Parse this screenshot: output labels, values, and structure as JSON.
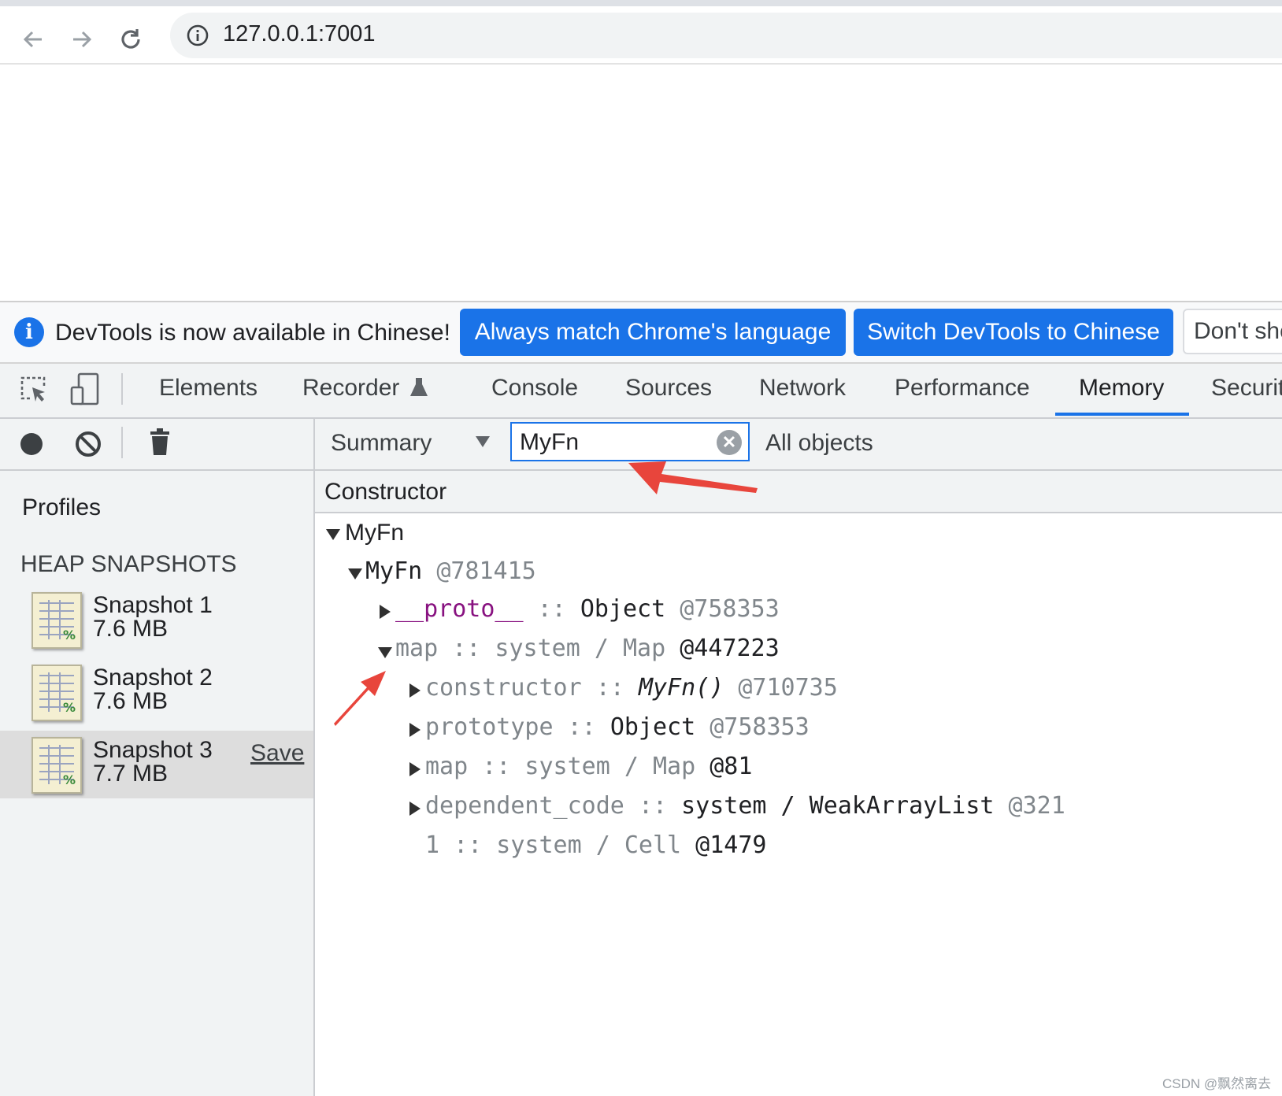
{
  "browser": {
    "url": "127.0.0.1:7001",
    "icons": [
      "back-arrow-icon",
      "forward-arrow-icon",
      "reload-icon",
      "site-info-icon"
    ]
  },
  "infobar": {
    "message": "DevTools is now available in Chinese!",
    "button_match": "Always match Chrome's language",
    "button_switch": "Switch DevTools to Chinese",
    "button_dont": "Don't show again",
    "accent": "#1a73e8"
  },
  "devtools": {
    "tabs": [
      "Elements",
      "Recorder",
      "Console",
      "Sources",
      "Network",
      "Performance",
      "Memory",
      "Security"
    ],
    "active_tab": "Memory"
  },
  "sidebar": {
    "profiles_label": "Profiles",
    "heap_label": "HEAP SNAPSHOTS",
    "snapshots": [
      {
        "name": "Snapshot 1",
        "size": "7.6 MB"
      },
      {
        "name": "Snapshot 2",
        "size": "7.6 MB"
      },
      {
        "name": "Snapshot 3",
        "size": "7.7 MB"
      }
    ],
    "save_label": "Save"
  },
  "main": {
    "view_select": "Summary",
    "filter_value": "MyFn",
    "scope_select": "All objects",
    "column_header": "Constructor",
    "tree": {
      "root": "MyFn",
      "instance_name": "MyFn",
      "instance_id": "@781415",
      "proto_key": "__proto__",
      "proto_sep": "::",
      "proto_type": "Object",
      "proto_id": "@758353",
      "map_key": "map",
      "map_sep": ":: system / Map",
      "map_id": "@447223",
      "children": {
        "constructor_key": "constructor",
        "constructor_sep": "::",
        "constructor_type": "MyFn()",
        "constructor_id": "@710735",
        "prototype_key": "prototype",
        "prototype_sep": "::",
        "prototype_type": "Object",
        "prototype_id": "@758353",
        "map_key": "map",
        "map_sep": ":: system / Map",
        "map_id": "@81",
        "dep_key": "dependent_code",
        "dep_sep": "::",
        "dep_type": "system / WeakArrayList",
        "dep_id": "@321",
        "cell_key": "1",
        "cell_sep": ":: system / Cell",
        "cell_id": "@1479"
      }
    }
  },
  "annotation_color": "#e8453c",
  "watermark": "CSDN @飘然离去"
}
